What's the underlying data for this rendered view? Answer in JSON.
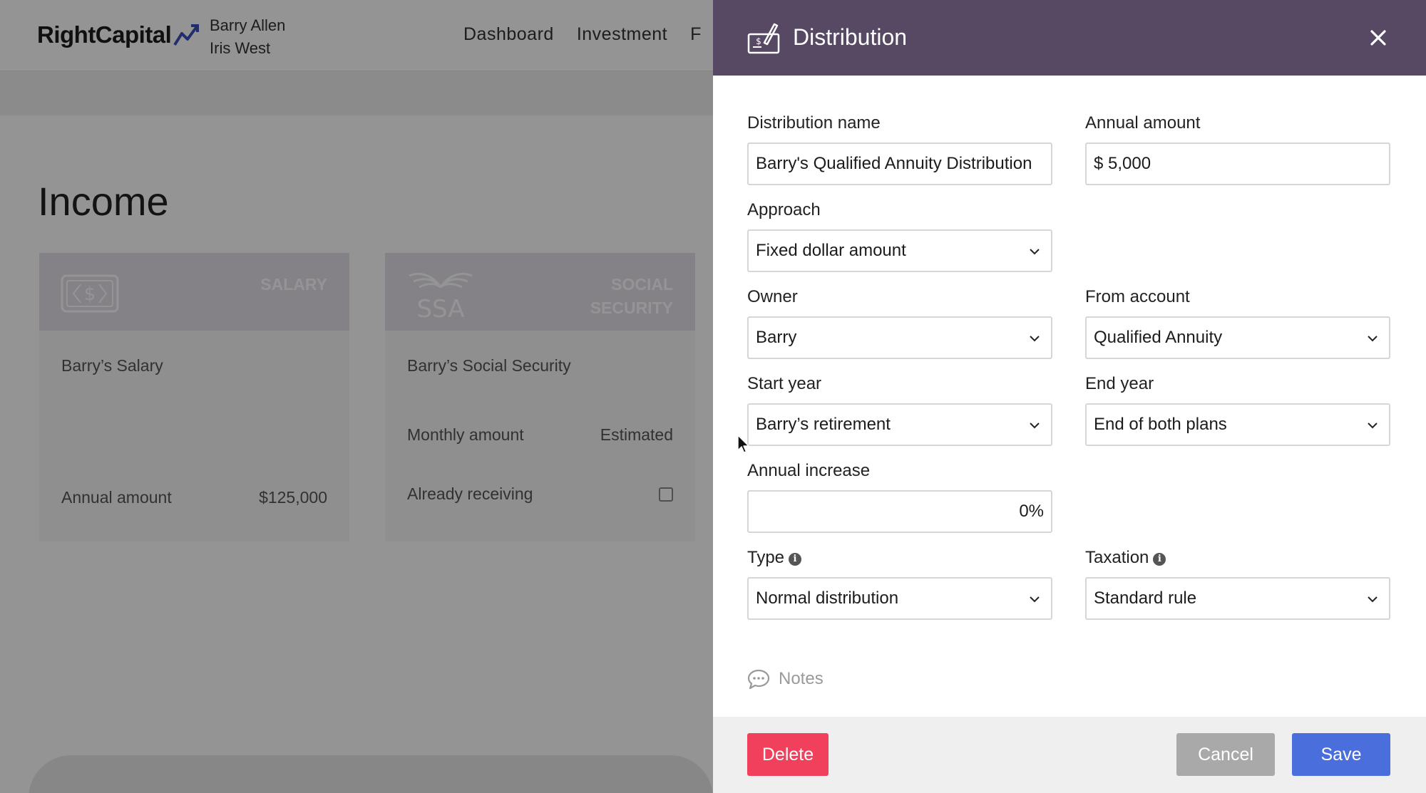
{
  "app": {
    "brand": "RightCapital",
    "clients": [
      "Barry Allen",
      "Iris West"
    ],
    "nav": [
      "Dashboard",
      "Investment",
      "F"
    ],
    "page_title": "Income",
    "cards": [
      {
        "type_lines": [
          "SALARY"
        ],
        "name": "Barry’s Salary",
        "rows": [
          {
            "label": "Annual amount",
            "value": "$125,000"
          }
        ]
      },
      {
        "type_lines": [
          "SOCIAL",
          "SECURITY"
        ],
        "icon_text": "SSA",
        "name": "Barry’s Social Security",
        "rows": [
          {
            "label": "Monthly amount",
            "value": "Estimated"
          },
          {
            "label": "Already receiving"
          }
        ]
      }
    ]
  },
  "drawer": {
    "title": "Distribution",
    "fields": {
      "distribution_name": {
        "label": "Distribution name",
        "value": "Barry's Qualified Annuity Distribution"
      },
      "annual_amount": {
        "label": "Annual amount",
        "value": "$ 5,000"
      },
      "approach": {
        "label": "Approach",
        "value": "Fixed dollar amount"
      },
      "owner": {
        "label": "Owner",
        "value": "Barry"
      },
      "from_account": {
        "label": "From account",
        "value": "Qualified Annuity"
      },
      "start_year": {
        "label": "Start year",
        "value": "Barry’s retirement"
      },
      "end_year": {
        "label": "End year",
        "value": "End of both plans"
      },
      "annual_increase": {
        "label": "Annual increase",
        "value": "0%"
      },
      "type": {
        "label": "Type",
        "value": "Normal distribution"
      },
      "taxation": {
        "label": "Taxation",
        "value": "Standard rule"
      }
    },
    "notes_label": "Notes",
    "buttons": {
      "delete": "Delete",
      "cancel": "Cancel",
      "save": "Save"
    }
  },
  "colors": {
    "header": "#574964",
    "delete": "#f0405b",
    "cancel": "#a9a9a9",
    "save": "#4a6edb"
  }
}
